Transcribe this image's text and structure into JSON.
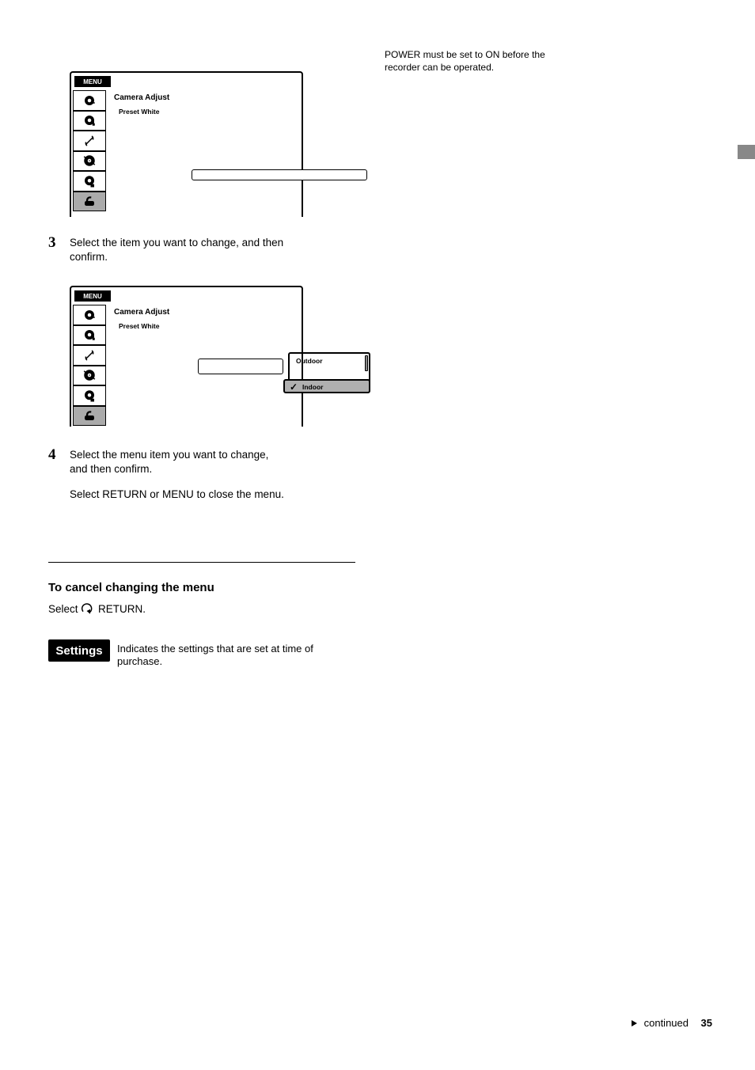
{
  "side_tab": "",
  "menu1": {
    "tab": "MENU",
    "title": "Camera Adjust",
    "row1": "Preset White",
    "row1_value": "Preset White"
  },
  "menu2": {
    "tab": "MENU",
    "title": "Camera Adjust",
    "row1": "Preset White",
    "sub_outdoor": "Outdoor",
    "sub_indoor": "Indoor",
    "check": "✓"
  },
  "step3_num": "3",
  "step3_text_a": "Select the item you want to change, and then",
  "step3_text_b": "confirm.",
  "step4_num": "4",
  "step4_text_a": "Select the menu item you want to change,",
  "step4_text_b": "and then confirm.",
  "returnmenu": "Select   RETURN   or   MENU   to close the menu.",
  "to_cancel_head": "To cancel changing the menu",
  "to_cancel_body_a": "Select         RETURN.",
  "to_cancel_body_b": "",
  "settings_badge": "Settings",
  "settings_text_a": "Indicates the settings that are set at time of",
  "settings_text_b": "purchase.",
  "right_note_a": "POWER must be set to ON before the",
  "right_note_b": "recorder can be operated.",
  "footer_text": "continued",
  "page_number": "35"
}
